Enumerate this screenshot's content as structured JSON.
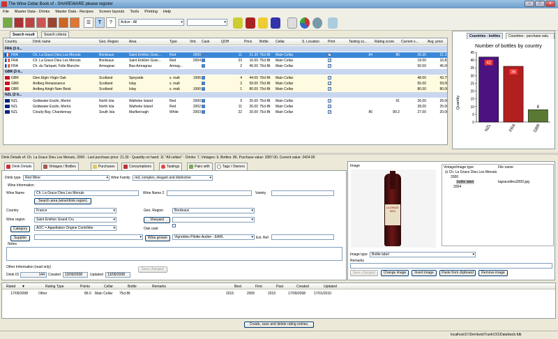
{
  "window": {
    "title": "The Wine Cellar Book of - SHAREWARE please register",
    "min": "–",
    "max": "□",
    "close": "x"
  },
  "menu": [
    "File",
    "Master Data - Drinks",
    "Master Data - Recipes",
    "Screen layouts",
    "Tools",
    "Printing",
    "Help"
  ],
  "toolbar": {
    "t_btn": "T",
    "help_btn": "?",
    "filter_value": "Active - All",
    "second_value": ""
  },
  "result_tabs": {
    "search_result": "Search result",
    "search_criteria": "Search criteria"
  },
  "grid": {
    "columns": [
      "Country",
      "Drink name",
      "Geo. Region",
      "Area",
      "Type",
      "Vint.",
      "Cask",
      "QOH",
      "Price",
      "Bottle",
      "Cellar",
      "S. Location",
      "Print",
      "Tasting sc...",
      "Rating score",
      "Current v...",
      "Avg. price"
    ],
    "groups": [
      {
        "label": "FRA (3 it...",
        "rows": [
          {
            "country": "FRA",
            "name": "Ch. La Grace Dieu Les Menuts",
            "geo": "Bordeaux",
            "area": "Saint Emilion Gran...",
            "type": "Red",
            "vint": "2000",
            "qoh": "11",
            "price": "21.30",
            "bottle": "75cl-Bt",
            "cellar": "Main Cellar",
            "tasting": "84",
            "rating": "86",
            "current": "26.30",
            "avg": "21.15",
            "selected": true
          },
          {
            "country": "FRA",
            "name": "Ch. La Grace Dieu Les Menuts",
            "geo": "Bordeaux",
            "area": "Saint Emilion Gran...",
            "type": "Red",
            "vint": "2004",
            "qoh": "23",
            "price": "16.50",
            "bottle": "75cl-Bt",
            "cellar": "Main Cellar",
            "tasting": "",
            "rating": "",
            "current": "19.00",
            "avg": "16.83"
          },
          {
            "country": "FRA",
            "name": "Ch. du Tariquet, Folle Blanche",
            "geo": "Armagnac",
            "area": "Bas-Armagnac",
            "type": "Armag...",
            "vint": "",
            "qoh": "2",
            "price": "45.00",
            "bottle": "70cl-Bt",
            "cellar": "Main Cellar",
            "tasting": "",
            "rating": "",
            "current": "50.00",
            "avg": "45.00"
          }
        ]
      },
      {
        "label": "GBR (3 it...",
        "rows": [
          {
            "country": "GBR",
            "name": "Glen Elgin Virgin Oak",
            "geo": "Scotland",
            "area": "Speyside",
            "type": "s. malt",
            "vint": "1996",
            "qoh": "4",
            "price": "44.00",
            "bottle": "70cl-Bt",
            "cellar": "Main Cellar",
            "tasting": "",
            "rating": "",
            "current": "48.00",
            "avg": "43.75"
          },
          {
            "country": "GBR",
            "name": "Ardbeg Renaissance",
            "geo": "Scotland",
            "area": "Islay",
            "type": "s. malt",
            "vint": "",
            "qoh": "3",
            "price": "59.00",
            "bottle": "70cl-Bt",
            "cellar": "Main Cellar",
            "tasting": "",
            "rating": "",
            "current": "65.00",
            "avg": "59.00"
          },
          {
            "country": "GBR",
            "name": "Ardbeg Airigh Nam Beist",
            "geo": "Scotland",
            "area": "Islay",
            "type": "s. malt",
            "vint": "1990",
            "qoh": "1",
            "price": "80.00",
            "bottle": "70cl-Bt",
            "cellar": "Main Cellar",
            "tasting": "",
            "rating": "",
            "current": "80.00",
            "avg": "80.00"
          }
        ]
      },
      {
        "label": "NZL (3 it...",
        "rows": [
          {
            "country": "NZL",
            "name": "Goldwater Esslin, Merlot",
            "geo": "North Isla",
            "area": "Waiheke Island",
            "type": "Red",
            "vint": "2000",
            "qoh": "9",
            "price": "25.00",
            "bottle": "75cl-Bt",
            "cellar": "Main Cellar",
            "tasting": "",
            "rating": "91",
            "current": "26.00",
            "avg": "26.00"
          },
          {
            "country": "NZL",
            "name": "Goldwater Esslin, Merlot",
            "geo": "North Isla",
            "area": "Waiheke Island",
            "type": "Red",
            "vint": "2002",
            "qoh": "11",
            "price": "26.00",
            "bottle": "75cl-Bt",
            "cellar": "Main Cellar",
            "tasting": "",
            "rating": "",
            "current": "28.00",
            "avg": "25.00"
          },
          {
            "country": "NZL",
            "name": "Cloudy Bay, Chardonnay",
            "geo": "South Isla",
            "area": "Marlborough",
            "type": "White",
            "vint": "2003",
            "qoh": "22",
            "price": "20.00",
            "bottle": "75cl-Bt",
            "cellar": "Main Cellar",
            "tasting": "86",
            "rating": "89.2",
            "current": "27.00",
            "avg": "20.00"
          }
        ]
      }
    ]
  },
  "chart_tabs": {
    "active": "Countries - bottles",
    "other": "Countries - purchase valu"
  },
  "chart_data": {
    "type": "bar",
    "title": "Number of bottles by country",
    "ylabel": "Quantity",
    "xlabel": "",
    "categories": [
      "NZL",
      "FRA",
      "GBR"
    ],
    "values": [
      42,
      36,
      8
    ],
    "ylim": [
      0,
      45
    ],
    "yticks": [
      0,
      5,
      10,
      15,
      20,
      25,
      30,
      35,
      40,
      45
    ],
    "colors": [
      "#4b1280",
      "#b11f1f",
      "#5a7a33"
    ]
  },
  "info_line": "Drink Details of: Ch. La Grace Dieu Les Menuts, 2000 - Last purchase price: 21.30 - Quantity on hand: 11        \"All cellars\" - Drinks: 7, Vintages: 9, Bottles: 86, Purchase value: 2087.00, Current value: 2424.00",
  "detail_tabs": [
    "Drink Details",
    "Vintages / Bottles",
    "Purchases",
    "Consumptions",
    "Tastings",
    "Pairs with",
    "Tags / Owners"
  ],
  "details": {
    "drink_type_lbl": "Drink type",
    "drink_type": "Red Wine",
    "family_lbl": "Wine Family",
    "family": "red, complex, elegant and distinctive",
    "wine_info_lbl": "Wine Information",
    "wine_name_lbl": "Wine Name",
    "wine_name": "Ch. La Grace Dieu Les Menuts",
    "wine_name2_lbl": "Wine Name 2",
    "variety_lbl": "Variety",
    "search_area_btn": "Search area (wine/drink region)",
    "country_lbl": "Country",
    "country": "France",
    "geo_region_lbl": "Geo. Region",
    "geo_region": "Bordeaux",
    "wine_region_lbl": "Wine region",
    "wine_region": "Saint Emilion Grand Cru",
    "vineyard_btn": "Vineyard",
    "category_btn": "Category",
    "category": "AOC = Appellation Origine Contrôlée",
    "oak_cask_lbl": "Oak cask",
    "supplier_btn": "Supplier",
    "wine_grower_btn": "Wine grower",
    "grower": "Vignobles Pilotte-Audier - EARL",
    "ext_ref_lbl": "Ext. Ref.",
    "notes_lbl": "Notes",
    "other_info_lbl": "Other Information (read only)",
    "drink_id_lbl": "Drink ID",
    "drink_id": "144",
    "created_lbl": "Created",
    "created": "13/09/2008",
    "updated_lbl": "Updated",
    "updated": "13/09/2008",
    "save_btn": "Save changes!"
  },
  "image_panel": {
    "image_lbl": "Image",
    "tree_h1": "Vintage/Image type",
    "tree_h2": "File name",
    "tree_root": "Ch. La Grace Dieu Les Menuts",
    "tree_2000": "2000",
    "tree_label": "bottle label",
    "tree_file": "lagracedieu2000.jpg",
    "tree_2004": "2004",
    "image_type_lbl": "Image type",
    "image_type": "Bottle label",
    "remarks_lbl": "Remarks",
    "save_btn": "Save changes!",
    "change_btn": "Change image",
    "insert_btn": "Insert image",
    "paste_btn": "Paste from clipboard",
    "remove_btn": "Remove image",
    "bottle_label_text": "LA GRACE DIEU"
  },
  "ratings": {
    "columns": [
      "Rated",
      "Rating Type",
      "Points",
      "Cellar",
      "Bottle",
      "Remarks",
      "Best",
      "First",
      "Past",
      "Created",
      "Updated"
    ],
    "sort_icon": "▼",
    "row": [
      "17/09/2008",
      "Other",
      "86.0",
      "Main Cellar",
      "75cl-Bt",
      "",
      "2015",
      "2005",
      "2015",
      "17/09/2008",
      "17/01/2010"
    ],
    "create_btn": "Create, save and delete rating entries."
  },
  "status": "localhost:D:\\Dev\\twcbTrunkV31\\Data\\twcb.fdb"
}
